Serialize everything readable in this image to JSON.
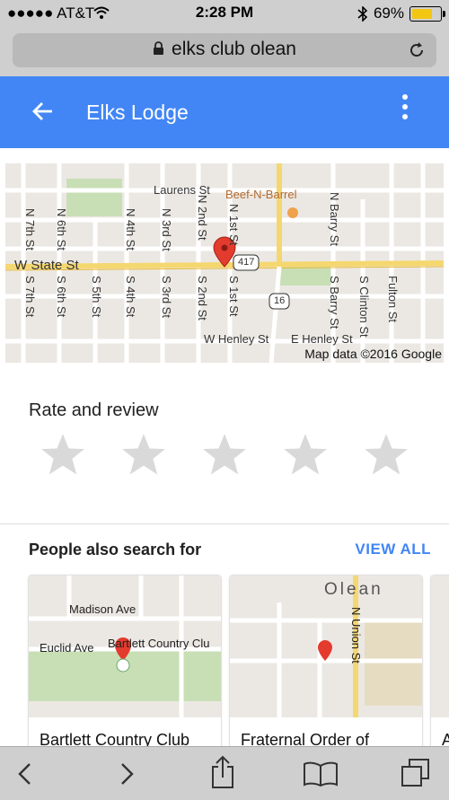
{
  "status_bar": {
    "carrier": "●●●●● AT&T",
    "time": "2:28 PM",
    "battery_percent": "69%",
    "icons": [
      "wifi-icon",
      "bluetooth-icon",
      "battery-icon"
    ]
  },
  "browser": {
    "url": "elks club olean",
    "icons": [
      "lock-icon",
      "reload-icon"
    ]
  },
  "app_bar": {
    "title": "Elks Lodge",
    "icons": [
      "back-arrow-icon",
      "more-vert-icon"
    ],
    "color": "#4286f5"
  },
  "map": {
    "street_labels": {
      "laurens": "Laurens St",
      "beef": "Beef-N-Barrel",
      "state": "W State St",
      "henley_w": "W Henley St",
      "henley_e": "E Henley St",
      "n7": "N 7th St",
      "n6": "N 6th St",
      "n4": "N 4th St",
      "n3": "N 3rd St",
      "n2": "N 2nd St",
      "n1": "N 1st St",
      "nbarry": "N Barry St",
      "s7": "S 7th St",
      "s6": "S 6th St",
      "s5": "S 5th St",
      "s4": "S 4th St",
      "s3": "S 3rd St",
      "s2": "S 2nd St",
      "s1": "S 1st St",
      "sbarry": "S Barry St",
      "sclinton": "S Clinton St",
      "fulton": "Fulton St",
      "route417": "417",
      "route16": "16"
    },
    "copyright": "Map data ©2016 Google"
  },
  "rate": {
    "title": "Rate and review",
    "star_count": 5,
    "rating": 0
  },
  "people_also_search": {
    "title": "People also search for",
    "view_all": "VIEW ALL",
    "cards": [
      {
        "name": "Bartlett Country Club",
        "map_labels": {
          "madison": "Madison Ave",
          "euclid": "Euclid Ave",
          "place": "Bartlett Country Clu"
        }
      },
      {
        "name": "Fraternal Order of",
        "map_labels": {
          "city": "Olean",
          "street": "N Union St"
        }
      },
      {
        "name": "A"
      }
    ]
  },
  "toolbar": {
    "items": [
      "back-icon",
      "forward-icon",
      "share-icon",
      "bookmarks-icon",
      "tabs-icon"
    ]
  }
}
